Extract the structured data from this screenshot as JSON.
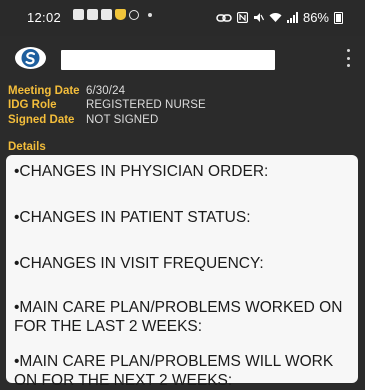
{
  "status_bar": {
    "time": "12:02",
    "battery_percent": "86%",
    "icons": [
      "photo-icon",
      "photo-icon",
      "photo-icon",
      "shield-icon",
      "smiley-icon",
      "dot-icon",
      "link-icon",
      "nfc-icon",
      "mute-icon",
      "wifi-icon",
      "signal-icon",
      "battery-icon"
    ]
  },
  "app_bar": {
    "logo": "app-logo-icon",
    "title": "",
    "menu_icon": "kebab-icon"
  },
  "meta": {
    "meeting_date_label": "Meeting Date",
    "meeting_date_value": "6/30/24",
    "idg_role_label": "IDG Role",
    "idg_role_value": "REGISTERED NURSE",
    "signed_date_label": "Signed Date",
    "signed_date_value": "NOT SIGNED",
    "details_label": "Details"
  },
  "details": {
    "lines": [
      "•CHANGES IN PHYSICIAN ORDER:",
      "•CHANGES IN PATIENT STATUS:",
      "•CHANGES IN VISIT FREQUENCY:",
      "•MAIN CARE PLAN/PROBLEMS WORKED ON FOR THE LAST 2 WEEKS:",
      "•MAIN CARE PLAN/PROBLEMS WILL WORK ON FOR THE NEXT 2 WEEKS:"
    ]
  },
  "colors": {
    "background": "#2b2b2b",
    "label_accent": "#f3bd3b",
    "value_text": "#dcdcdc",
    "card_bg": "#f7f7f7",
    "logo_blue": "#1e5f9e"
  }
}
